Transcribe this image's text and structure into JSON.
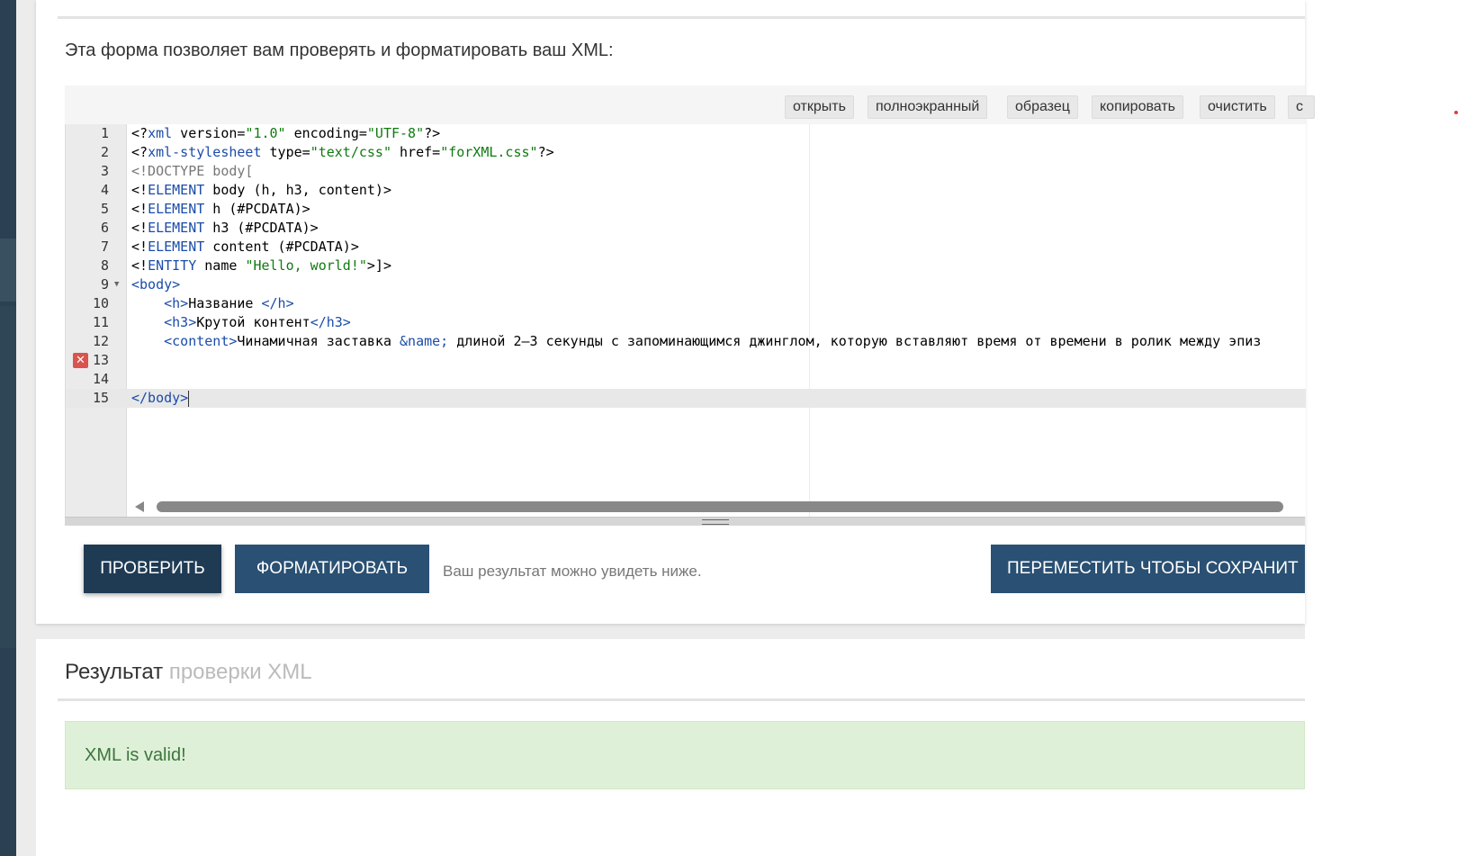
{
  "intro_text": "Эта форма позволяет вам проверять и форматировать ваш XML:",
  "toolbar": {
    "open": "открыть",
    "fullscreen": "полноэкранный",
    "sample": "образец",
    "copy": "копировать",
    "clear": "очистить",
    "cut_off": "с"
  },
  "editor": {
    "line_numbers": [
      "1",
      "2",
      "3",
      "4",
      "5",
      "6",
      "7",
      "8",
      "9",
      "10",
      "11",
      "12",
      "13",
      "14",
      "15"
    ],
    "active_line": 15,
    "error_line": 13,
    "lines": [
      "<?xml version=\"1.0\" encoding=\"UTF-8\"?>",
      "<?xml-stylesheet type=\"text/css\" href=\"forXML.css\"?>",
      "<!DOCTYPE body[",
      "<!ELEMENT body (h, h3, content)>",
      "<!ELEMENT h (#PCDATA)>",
      "<!ELEMENT h3 (#PCDATA)>",
      "<!ELEMENT content (#PCDATA)>",
      "<!ENTITY name \"Hello, world!\">]>",
      "<body>",
      "    <h>Название </h>",
      "    <h3>Крутой контент</h3>",
      "    <content>Чинамичная заставка &name; длиной 2–3 секунды с запоминающимся джинглом, которую вставляют время от времени в ролик между эпиз",
      "",
      "",
      "</body>"
    ]
  },
  "buttons": {
    "check": "ПРОВЕРИТЬ",
    "format": "ФОРМАТИРОВАТЬ",
    "move": "ПЕРЕМЕСТИТЬ ЧТОБЫ СОХРАНИТ"
  },
  "hint_text": "Ваш результат можно увидеть ниже.",
  "result": {
    "title_main": "Результат",
    "title_sub": "проверки XML",
    "message": "XML is valid!"
  },
  "colors": {
    "primary_dark": "#1f3b54",
    "primary": "#2a5073",
    "success_bg": "#dff0d8",
    "success_text": "#3c763d",
    "xml_keyword": "#1b4ca8",
    "xml_string": "#107a10"
  }
}
